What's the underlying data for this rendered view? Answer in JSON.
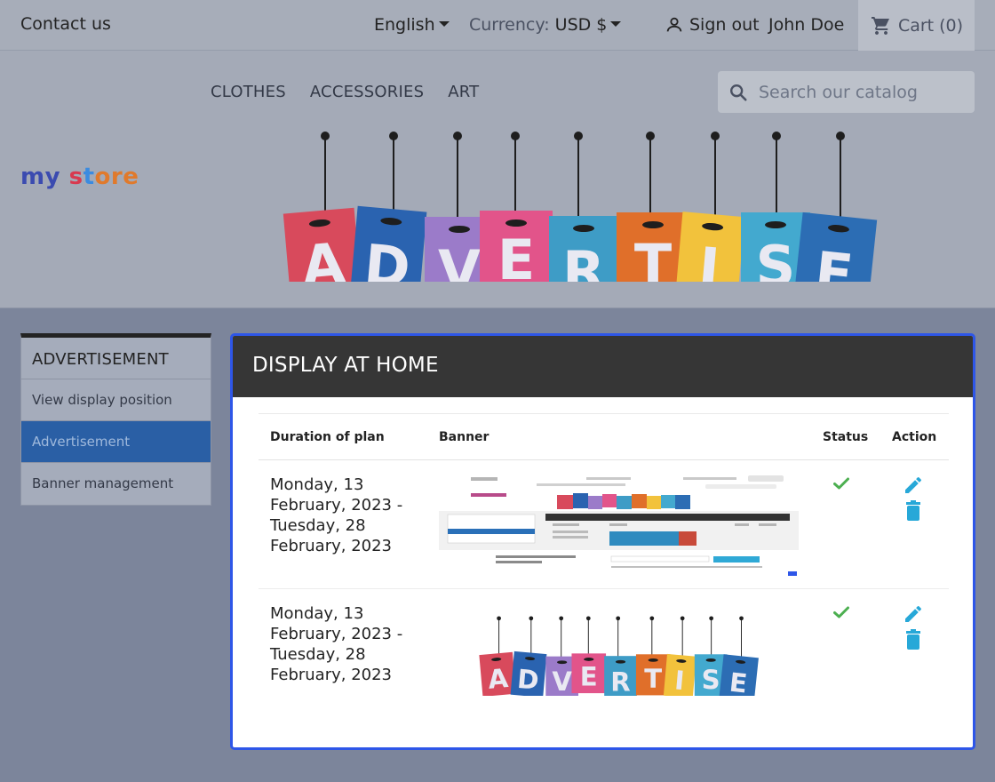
{
  "topnav": {
    "contact": "Contact us",
    "language": "English",
    "currency_label": "Currency:",
    "currency_value": "USD $",
    "sign_out": "Sign out",
    "user_name": "John Doe",
    "cart": "Cart (0)"
  },
  "header": {
    "logo": [
      "my",
      " ",
      "s",
      "t",
      "ore"
    ],
    "menu": [
      "CLOTHES",
      "ACCESSORIES",
      "ART"
    ],
    "search_placeholder": "Search our catalog",
    "banner_letters": [
      "A",
      "D",
      "V",
      "E",
      "R",
      "T",
      "I",
      "S",
      "E"
    ],
    "banner_colors": [
      "#d84a5c",
      "#2a63b0",
      "#9b7bc9",
      "#e2548a",
      "#3e9cc6",
      "#e06f2a",
      "#f2c23c",
      "#43a9cf",
      "#2c6db4"
    ]
  },
  "sidebar": {
    "title": "ADVERTISEMENT",
    "items": [
      {
        "label": "View display position"
      },
      {
        "label": "Advertisement"
      },
      {
        "label": "Banner management"
      }
    ]
  },
  "panel": {
    "title": "DISPLAY AT HOME",
    "columns": {
      "duration": "Duration of plan",
      "banner": "Banner",
      "status": "Status",
      "action": "Action"
    },
    "rows": [
      {
        "duration": "Monday, 13 February, 2023 - Tuesday, 28 February, 2023",
        "banner_type": "screenshot-thumbnail"
      },
      {
        "duration": "Monday, 13 February, 2023 - Tuesday, 28 February, 2023",
        "banner_type": "advertise-tags"
      }
    ]
  },
  "colors": {
    "accent": "#2e56e8",
    "active_item": "#2a5fa5",
    "status_ok": "#4caf50",
    "action_icon": "#27a8d8"
  }
}
